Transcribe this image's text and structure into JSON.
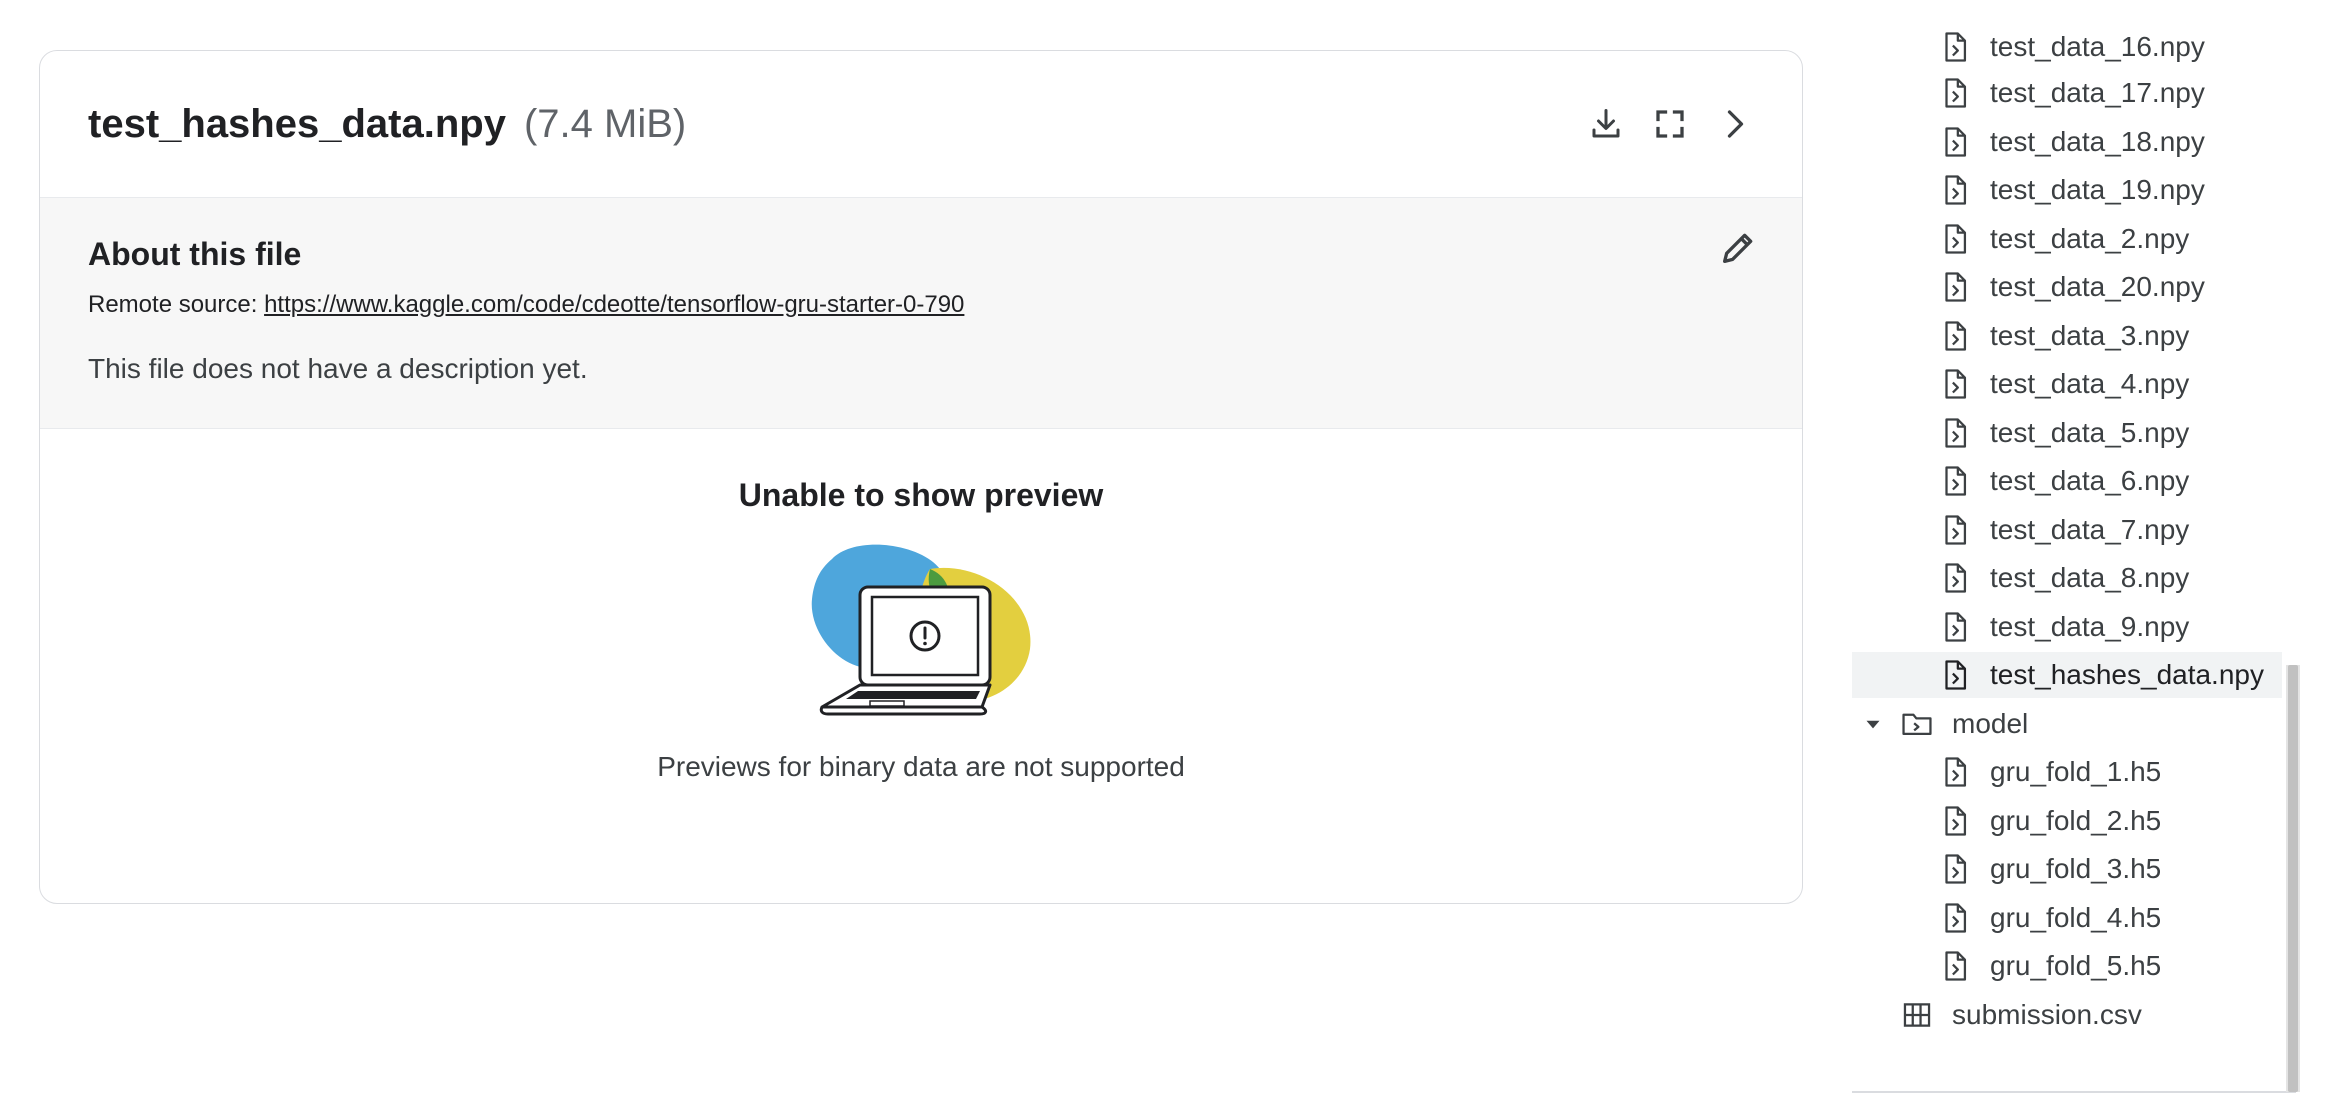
{
  "file": {
    "name": "test_hashes_data.npy",
    "size": "(7.4 MiB)"
  },
  "about": {
    "title": "About this file",
    "remote_label": "Remote source:",
    "remote_url": "https://www.kaggle.com/code/cdeotte/tensorflow-gru-starter-0-790",
    "description": "This file does not have a description yet."
  },
  "preview": {
    "title": "Unable to show preview",
    "message": "Previews for binary data are not supported"
  },
  "tree": {
    "partial_item": "test_data_16.npy",
    "items": [
      "test_data_17.npy",
      "test_data_18.npy",
      "test_data_19.npy",
      "test_data_2.npy",
      "test_data_20.npy",
      "test_data_3.npy",
      "test_data_4.npy",
      "test_data_5.npy",
      "test_data_6.npy",
      "test_data_7.npy",
      "test_data_8.npy",
      "test_data_9.npy",
      "test_hashes_data.npy"
    ],
    "selected": "test_hashes_data.npy",
    "folder": "model",
    "model_items": [
      "gru_fold_1.h5",
      "gru_fold_2.h5",
      "gru_fold_3.h5",
      "gru_fold_4.h5",
      "gru_fold_5.h5"
    ],
    "root_file": "submission.csv"
  },
  "icons": [
    "download-icon",
    "fullscreen-icon",
    "chevron-right-icon",
    "pencil-icon",
    "file-code-icon",
    "folder-icon",
    "table-icon",
    "caret-down-icon"
  ],
  "colors": {
    "blob_blue": "#4ea6dc",
    "blob_yellow": "#e3cf3f",
    "blob_green": "#4c9b3f",
    "selected_row": "#f1f3f4"
  }
}
